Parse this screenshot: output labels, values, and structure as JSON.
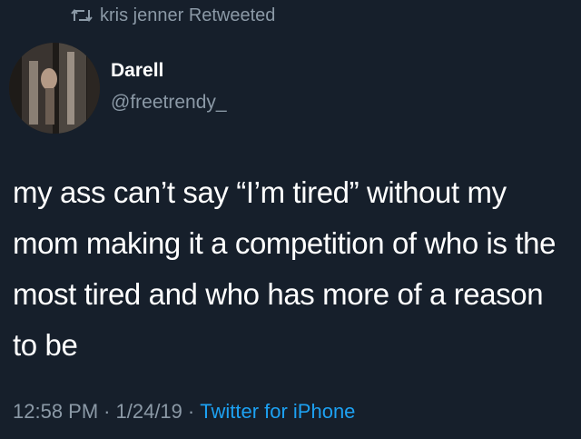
{
  "retweet": {
    "icon": "retweet-icon",
    "text": "kris jenner Retweeted"
  },
  "author": {
    "name": "Darell",
    "handle": "@freetrendy_",
    "avatar_icon": "avatar-photo"
  },
  "tweet": {
    "text": "my ass can’t say “I’m tired” without my mom making it a competition of who is the most tired and who has more of a reason to be"
  },
  "meta": {
    "time": "12:58 PM",
    "separator": "·",
    "date": "1/24/19",
    "source": "Twitter for iPhone"
  },
  "colors": {
    "background": "#161f2b",
    "text": "#ffffff",
    "muted": "#8b99a6",
    "link": "#1da1f2"
  }
}
